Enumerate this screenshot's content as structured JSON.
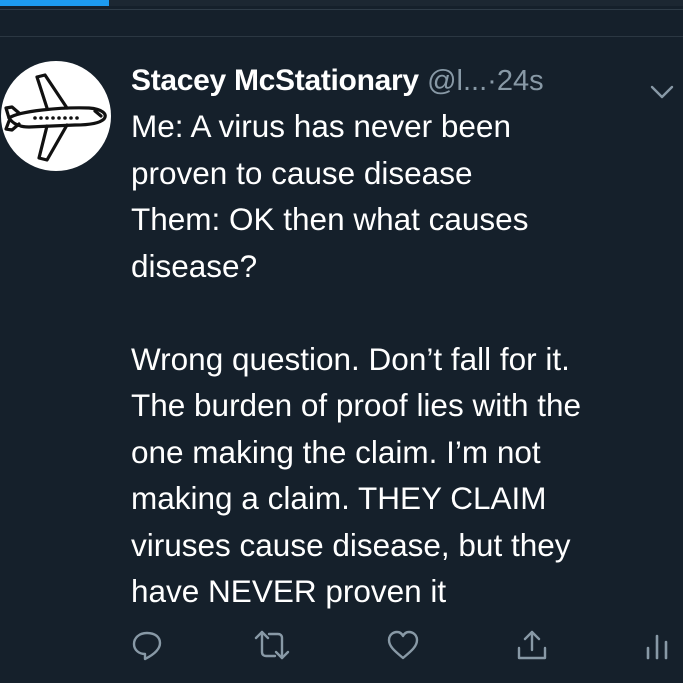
{
  "theme": {
    "background": "#15202b",
    "text": "#ffffff",
    "muted": "#8899a6",
    "accent": "#1d9bf0"
  },
  "top_bar": {
    "progress_fraction": 0.16
  },
  "tweet": {
    "author": {
      "display_name": "Stacey McStationary",
      "handle": "@l...",
      "avatar_icon": "airplane-icon"
    },
    "separator": "·",
    "timestamp": "24s",
    "menu_icon": "chevron-down-icon",
    "lines": [
      "Me: A virus has never been",
      "proven to cause disease",
      "Them: OK then what causes",
      "disease?",
      "",
      "Wrong question. Don’t fall for it.",
      "The burden of proof lies with the",
      "one making the claim. I’m not",
      "making a claim. THEY CLAIM",
      "viruses cause disease, but they",
      "have NEVER proven it"
    ],
    "actions": [
      "reply-icon",
      "retweet-icon",
      "like-icon",
      "share-icon",
      "analytics-icon"
    ]
  }
}
